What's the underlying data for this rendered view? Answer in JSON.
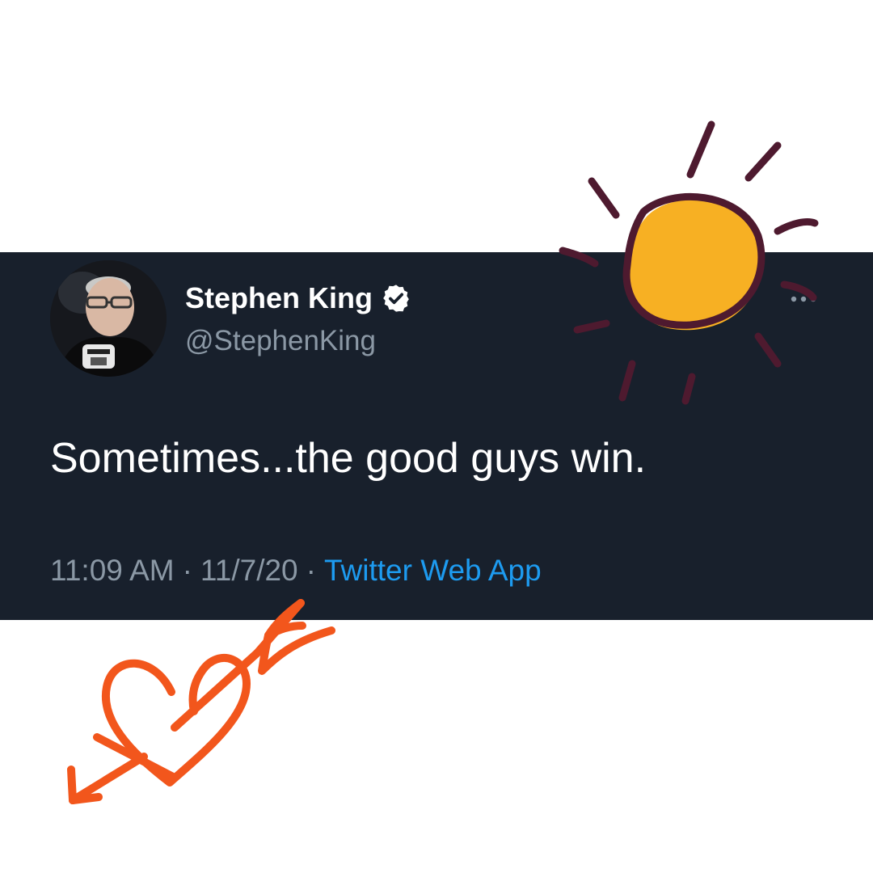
{
  "tweet": {
    "author": {
      "display_name": "Stephen King",
      "handle": "@StephenKing",
      "verified": true
    },
    "text": "Sometimes...the good guys win.",
    "time": "11:09 AM",
    "date": "11/7/20",
    "separator": "·",
    "source": "Twitter Web App"
  },
  "icons": {
    "verified": "verified-badge-icon",
    "more": "more-horizontal-icon"
  },
  "colors": {
    "card_background": "#18202c",
    "page_background": "#ffffff",
    "text_primary": "#ffffff",
    "text_secondary": "#8b98a5",
    "link": "#1d9bf0",
    "sun_fill": "#f7b023",
    "sun_outline": "#4e1a2f",
    "heart_stroke": "#f2561c"
  }
}
